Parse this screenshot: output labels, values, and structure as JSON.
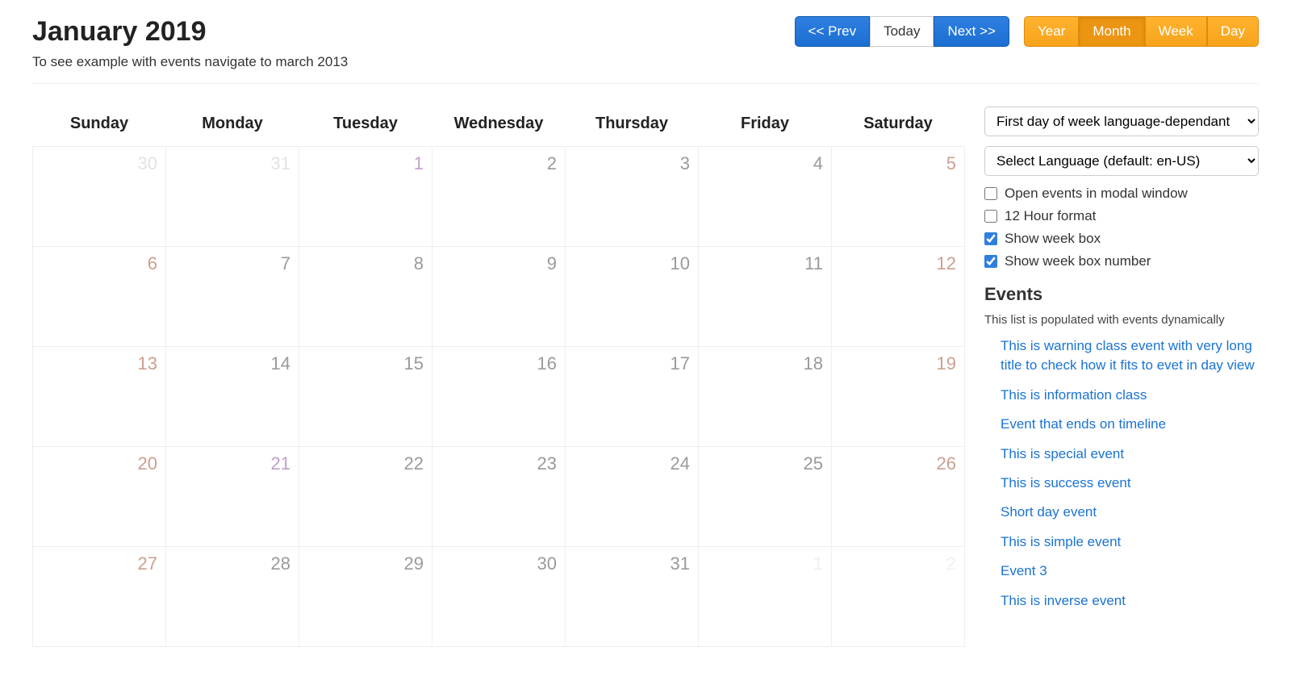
{
  "title": "January 2019",
  "subheading": "To see example with events navigate to march 2013",
  "nav": {
    "prev": "<< Prev",
    "today": "Today",
    "next": "Next >>"
  },
  "view": {
    "year": "Year",
    "month": "Month",
    "week": "Week",
    "day": "Day"
  },
  "weekdays": [
    "Sunday",
    "Monday",
    "Tuesday",
    "Wednesday",
    "Thursday",
    "Friday",
    "Saturday"
  ],
  "weeks": [
    [
      {
        "n": 30,
        "cls": "other"
      },
      {
        "n": 31,
        "cls": "other"
      },
      {
        "n": 1,
        "cls": "special"
      },
      {
        "n": 2,
        "cls": ""
      },
      {
        "n": 3,
        "cls": ""
      },
      {
        "n": 4,
        "cls": ""
      },
      {
        "n": 5,
        "cls": "saturday"
      }
    ],
    [
      {
        "n": 6,
        "cls": "sunday"
      },
      {
        "n": 7,
        "cls": ""
      },
      {
        "n": 8,
        "cls": ""
      },
      {
        "n": 9,
        "cls": ""
      },
      {
        "n": 10,
        "cls": ""
      },
      {
        "n": 11,
        "cls": ""
      },
      {
        "n": 12,
        "cls": "saturday"
      }
    ],
    [
      {
        "n": 13,
        "cls": "sunday"
      },
      {
        "n": 14,
        "cls": ""
      },
      {
        "n": 15,
        "cls": ""
      },
      {
        "n": 16,
        "cls": ""
      },
      {
        "n": 17,
        "cls": ""
      },
      {
        "n": 18,
        "cls": ""
      },
      {
        "n": 19,
        "cls": "saturday"
      }
    ],
    [
      {
        "n": 20,
        "cls": "sunday"
      },
      {
        "n": 21,
        "cls": "special"
      },
      {
        "n": 22,
        "cls": ""
      },
      {
        "n": 23,
        "cls": ""
      },
      {
        "n": 24,
        "cls": ""
      },
      {
        "n": 25,
        "cls": ""
      },
      {
        "n": 26,
        "cls": "saturday"
      }
    ],
    [
      {
        "n": 27,
        "cls": "sunday"
      },
      {
        "n": 28,
        "cls": ""
      },
      {
        "n": 29,
        "cls": ""
      },
      {
        "n": 30,
        "cls": ""
      },
      {
        "n": 31,
        "cls": ""
      },
      {
        "n": 1,
        "cls": "very-faint"
      },
      {
        "n": 2,
        "cls": "very-faint"
      }
    ]
  ],
  "sidebar": {
    "first_day_select": "First day of week language-dependant",
    "lang_select": "Select Language (default: en-US)",
    "checkboxes": [
      {
        "label": "Open events in modal window",
        "checked": false
      },
      {
        "label": "12 Hour format",
        "checked": false
      },
      {
        "label": "Show week box",
        "checked": true
      },
      {
        "label": "Show week box number",
        "checked": true
      }
    ],
    "events_heading": "Events",
    "events_note": "This list is populated with events dynamically",
    "events": [
      "This is warning class event with very long title to check how it fits to evet in day view",
      "This is information class",
      "Event that ends on timeline",
      "This is special event",
      "This is success event",
      "Short day event",
      "This is simple event",
      "Event 3",
      "This is inverse event"
    ]
  }
}
